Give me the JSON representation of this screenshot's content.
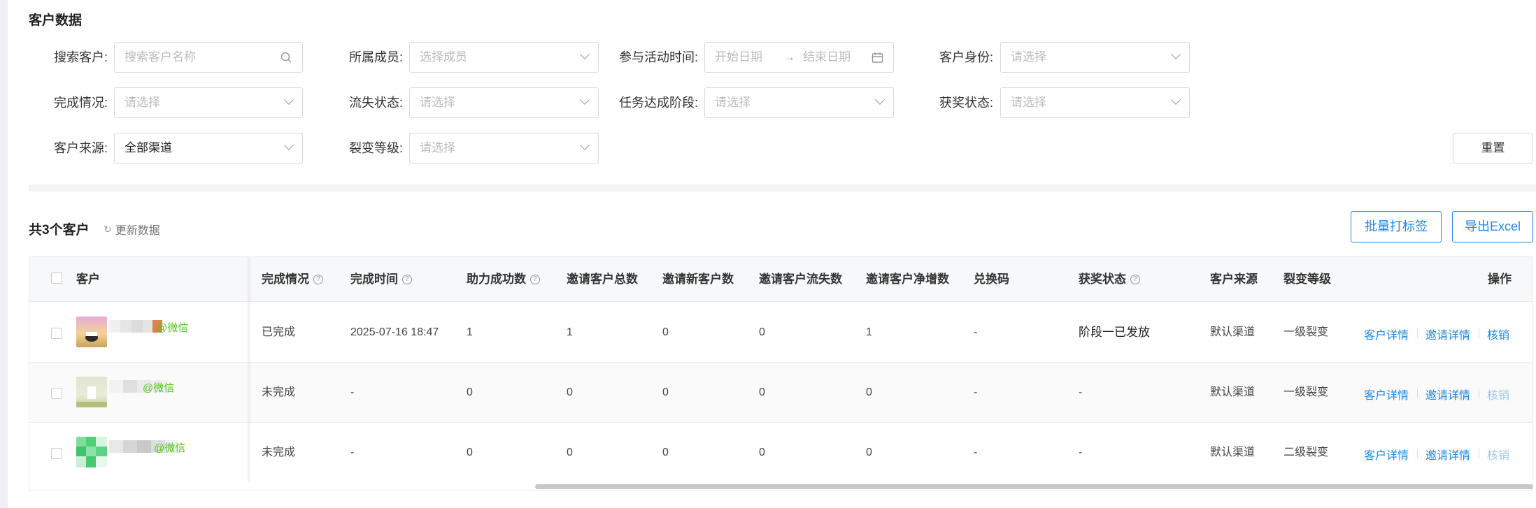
{
  "page": {
    "title": "客户数据"
  },
  "filters": {
    "search": {
      "label": "搜索客户:",
      "placeholder": "搜索客户名称"
    },
    "member": {
      "label": "所属成员:",
      "placeholder": "选择成员"
    },
    "activity_time": {
      "label": "参与活动时间:",
      "start_placeholder": "开始日期",
      "separator": "→",
      "end_placeholder": "结束日期"
    },
    "identity": {
      "label": "客户身份:",
      "placeholder": "请选择"
    },
    "completion": {
      "label": "完成情况:",
      "placeholder": "请选择"
    },
    "churn": {
      "label": "流失状态:",
      "placeholder": "请选择"
    },
    "task_stage": {
      "label": "任务达成阶段:",
      "placeholder": "请选择"
    },
    "award_status": {
      "label": "获奖状态:",
      "placeholder": "请选择"
    },
    "source": {
      "label": "客户来源:",
      "value": "全部渠道"
    },
    "fission_level": {
      "label": "裂变等级:",
      "placeholder": "请选择"
    },
    "reset_label": "重置"
  },
  "summary": {
    "count_text": "共3个客户",
    "refresh_label": "更新数据"
  },
  "actions": {
    "batch_tag_label": "批量打标签",
    "export_label": "导出Excel"
  },
  "table": {
    "columns": {
      "customer": "客户",
      "completion": "完成情况",
      "completion_time": "完成时间",
      "assist_success": "助力成功数",
      "invite_total": "邀请客户总数",
      "invite_new": "邀请新客户数",
      "invite_churn": "邀请客户流失数",
      "invite_net": "邀请客户净增数",
      "redeem_code": "兑换码",
      "award_status": "获奖状态",
      "source": "客户来源",
      "fission_level": "裂变等级",
      "operations": "操作"
    },
    "rows": [
      {
        "wechat_tag": "@微信",
        "completion": "已完成",
        "completion_time": "2025-07-16 18:47",
        "assist_success": "1",
        "invite_total": "1",
        "invite_new": "0",
        "invite_churn": "0",
        "invite_net": "1",
        "redeem_code": "-",
        "award_status": "阶段一已发放",
        "source": "默认渠道",
        "fission_level": "一级裂变",
        "op_detail": "客户详情",
        "op_invite": "邀请详情",
        "op_verify": "核销",
        "verify_enabled": true
      },
      {
        "wechat_tag": "@微信",
        "completion": "未完成",
        "completion_time": "-",
        "assist_success": "0",
        "invite_total": "0",
        "invite_new": "0",
        "invite_churn": "0",
        "invite_net": "0",
        "redeem_code": "-",
        "award_status": "-",
        "source": "默认渠道",
        "fission_level": "一级裂变",
        "op_detail": "客户详情",
        "op_invite": "邀请详情",
        "op_verify": "核销",
        "verify_enabled": false
      },
      {
        "wechat_tag": "@微信",
        "completion": "未完成",
        "completion_time": "-",
        "assist_success": "0",
        "invite_total": "0",
        "invite_new": "0",
        "invite_churn": "0",
        "invite_net": "0",
        "redeem_code": "-",
        "award_status": "-",
        "source": "默认渠道",
        "fission_level": "二级裂变",
        "op_detail": "客户详情",
        "op_invite": "邀请详情",
        "op_verify": "核销",
        "verify_enabled": false
      }
    ]
  },
  "colors": {
    "link": "#1e88e5",
    "link_disabled": "#9cc8f0",
    "wechat": "#52c41a"
  },
  "icons": {
    "search": "search-icon",
    "calendar": "calendar-icon",
    "chevron": "chevron-down-icon",
    "refresh": "refresh-icon",
    "help": "question-circle-icon"
  }
}
